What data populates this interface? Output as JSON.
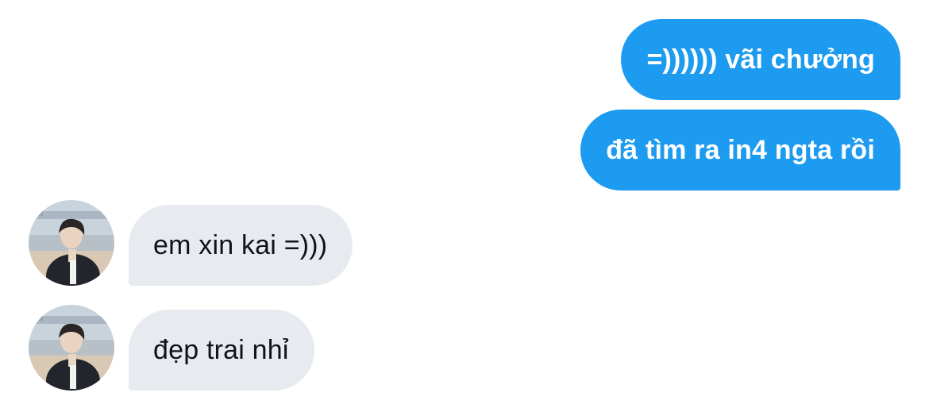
{
  "conversation": {
    "messages": [
      {
        "direction": "sent",
        "text": "=)))))) vãi chưởng"
      },
      {
        "direction": "sent",
        "text": "đã tìm ra in4 ngta rồi"
      },
      {
        "direction": "received",
        "text": "em xin kai =)))"
      },
      {
        "direction": "received",
        "text": "đẹp trai nhỉ"
      }
    ]
  },
  "colors": {
    "sent_bubble": "#1d9bf0",
    "received_bubble": "#e7ebef",
    "sent_text": "#ffffff",
    "received_text": "#0f1419"
  },
  "icons": {
    "avatar": "contact-avatar-photo"
  }
}
